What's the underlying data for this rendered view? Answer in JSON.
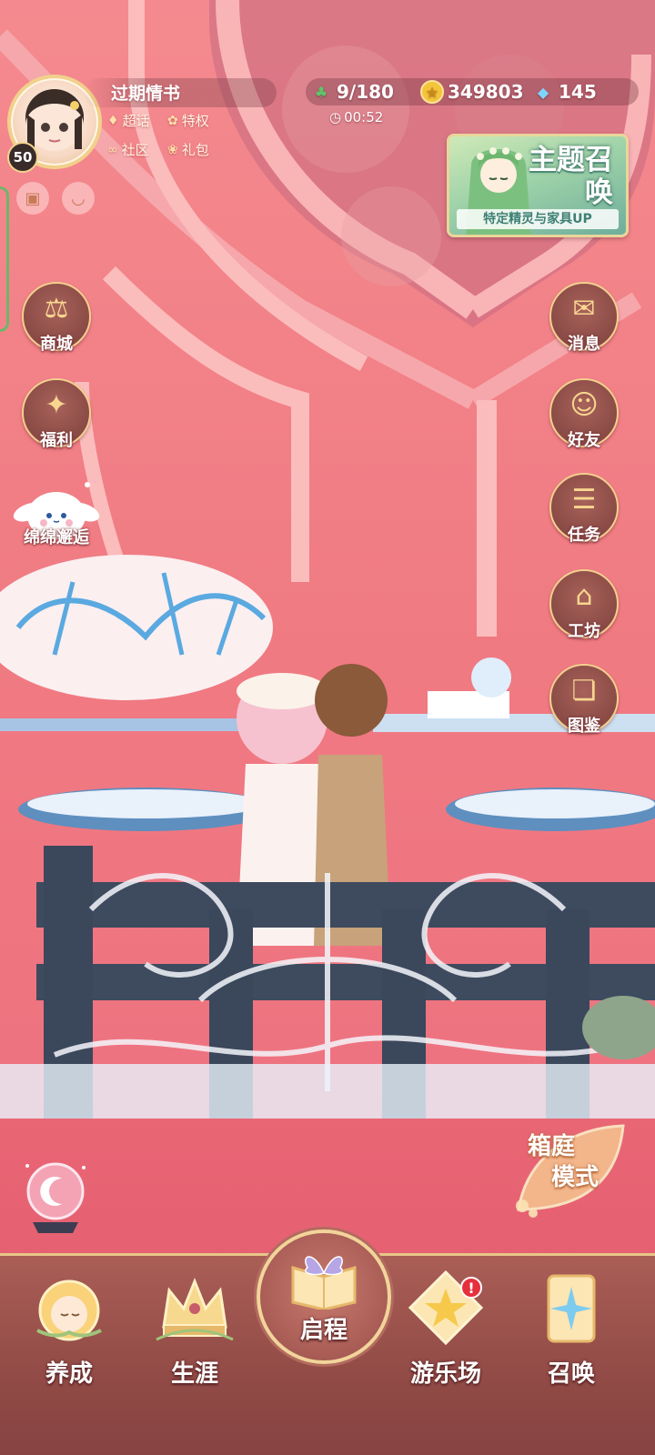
{
  "player": {
    "name": "过期情书",
    "level": "50"
  },
  "links": {
    "chat": "超话",
    "privilege": "特权",
    "community": "社区",
    "gift": "礼包"
  },
  "resources": {
    "stamina": "9/180",
    "gold": "349803",
    "gems": "145",
    "timer": "00:52"
  },
  "banner": {
    "title": "主题召唤",
    "subtitle": "特定精灵与家具UP"
  },
  "left_menu": {
    "shop": "商城",
    "welfare": "福利",
    "event": "绵绵邂逅"
  },
  "right_menu": {
    "messages": "消息",
    "friends": "好友",
    "tasks": "任务",
    "workshop": "工坊",
    "codex": "图鉴"
  },
  "garden_mode": {
    "line1": "箱庭",
    "line2": "模式"
  },
  "bottom_nav": {
    "cultivate": "养成",
    "career": "生涯",
    "start": "启程",
    "playground": "游乐场",
    "summon": "召唤",
    "badge": "!"
  },
  "colors": {
    "background": "#f07a82",
    "nav_bar": "#924b46",
    "gold_trim": "#f1d49a",
    "badge": "#e5303d"
  }
}
